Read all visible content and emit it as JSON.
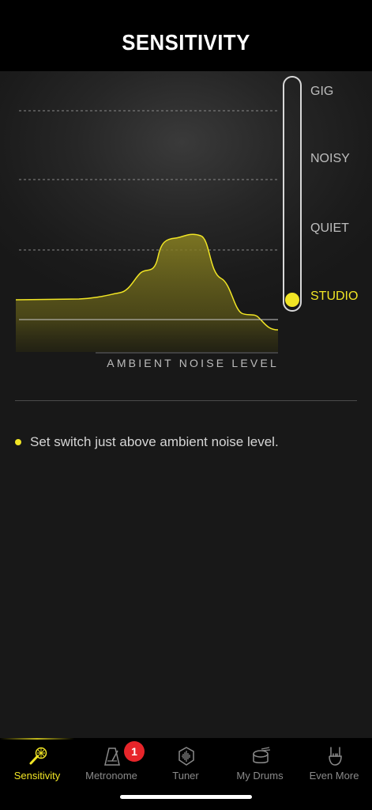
{
  "header": {
    "title": "SENSITIVITY"
  },
  "graph": {
    "axis_label": "AMBIENT NOISE LEVEL",
    "accent_color": "#f1e525"
  },
  "sensitivity_levels": {
    "items": [
      {
        "label": "GIG",
        "selected": false
      },
      {
        "label": "NOISY",
        "selected": false
      },
      {
        "label": "QUIET",
        "selected": false
      },
      {
        "label": "STUDIO",
        "selected": true
      }
    ],
    "selected": "STUDIO"
  },
  "tip": {
    "text": "Set switch just above ambient noise level."
  },
  "tabbar": {
    "tabs": [
      {
        "label": "Sensitivity",
        "icon": "microphone-sensitivity-icon",
        "active": true
      },
      {
        "label": "Metronome",
        "icon": "metronome-icon",
        "active": false
      },
      {
        "label": "Tuner",
        "icon": "tuner-icon",
        "active": false
      },
      {
        "label": "My Drums",
        "icon": "drums-icon",
        "active": false
      },
      {
        "label": "Even More",
        "icon": "rock-hand-icon",
        "active": false
      }
    ],
    "metronome_badge": "1"
  }
}
